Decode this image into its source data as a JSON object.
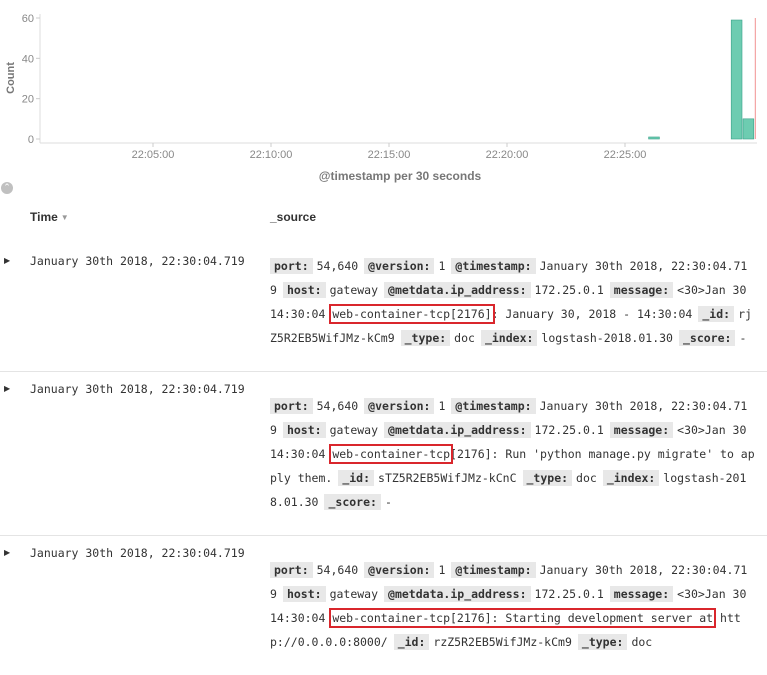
{
  "chart_data": {
    "type": "bar",
    "ylabel": "Count",
    "xlabel": "@timestamp per 30 seconds",
    "yticks": [
      0,
      20,
      40,
      60
    ],
    "ylim": [
      0,
      60
    ],
    "xtick_labels": [
      "22:05:00",
      "22:10:00",
      "22:15:00",
      "22:20:00",
      "22:25:00"
    ],
    "x": [
      "22:26:00",
      "22:29:30",
      "22:30:00"
    ],
    "values": [
      1,
      59,
      10
    ],
    "bar_color": "#6dccb1",
    "marker_color": "#f29191"
  },
  "ui": {
    "collapse_icon": "chevron-up-icon",
    "expand_icon": "triangle-right-icon"
  },
  "table": {
    "columns": [
      "Time",
      "_source"
    ],
    "rows": [
      {
        "time": "January 30th 2018, 22:30:04.719",
        "fields": [
          {
            "k": "port:",
            "v": "54,640"
          },
          {
            "k": "@version:",
            "v": "1"
          },
          {
            "k": "@timestamp:",
            "v": "January 30th 2018, 22:30:04.719"
          },
          {
            "k": "host:",
            "v": "gateway"
          },
          {
            "k": "@metdata.ip_address:",
            "v": "172.25.0.1"
          },
          {
            "k": "message:",
            "v_pre": "<30>Jan 30 14:30:04 ",
            "v_hl": "web-container-tcp[2176]",
            "v_post": ": January 30, 2018 - 14:30:04"
          },
          {
            "k": "_id:",
            "v": "rjZ5R2EB5WifJMz-kCm9"
          },
          {
            "k": "_type:",
            "v": "doc"
          },
          {
            "k": "_index:",
            "v": "logstash-2018.01.30"
          },
          {
            "k": "_score:",
            "v": "-"
          }
        ]
      },
      {
        "time": "January 30th 2018, 22:30:04.719",
        "fields": [
          {
            "k": "port:",
            "v": "54,640"
          },
          {
            "k": "@version:",
            "v": "1"
          },
          {
            "k": "@timestamp:",
            "v": "January 30th 2018, 22:30:04.719"
          },
          {
            "k": "host:",
            "v": "gateway"
          },
          {
            "k": "@metdata.ip_address:",
            "v": "172.25.0.1"
          },
          {
            "k": "message:",
            "v_pre": "<30>Jan 30 14:30:04 ",
            "v_hl": "web-container-tcp",
            "v_post": "[2176]: Run 'python manage.py migrate' to apply them."
          },
          {
            "k": "_id:",
            "v": "sTZ5R2EB5WifJMz-kCnC"
          },
          {
            "k": "_type:",
            "v": "doc"
          },
          {
            "k": "_index:",
            "v": "logstash-2018.01.30"
          },
          {
            "k": "_score:",
            "v": "-"
          }
        ]
      },
      {
        "time": "January 30th 2018, 22:30:04.719",
        "fields": [
          {
            "k": "port:",
            "v": "54,640"
          },
          {
            "k": "@version:",
            "v": "1"
          },
          {
            "k": "@timestamp:",
            "v": "January 30th 2018, 22:30:04.719"
          },
          {
            "k": "host:",
            "v": "gateway"
          },
          {
            "k": "@metdata.ip_address:",
            "v": "172.25.0.1"
          },
          {
            "k": "message:",
            "v_pre": "<30>Jan 30 14:30:04 ",
            "v_hl": "web-container-tcp[2176]: Starting development server at",
            "v_post": " http://0.0.0.0:8000/"
          },
          {
            "k": "_id:",
            "v": "rzZ5R2EB5WifJMz-kCm9"
          },
          {
            "k": "_type:",
            "v": "doc"
          }
        ]
      }
    ]
  }
}
